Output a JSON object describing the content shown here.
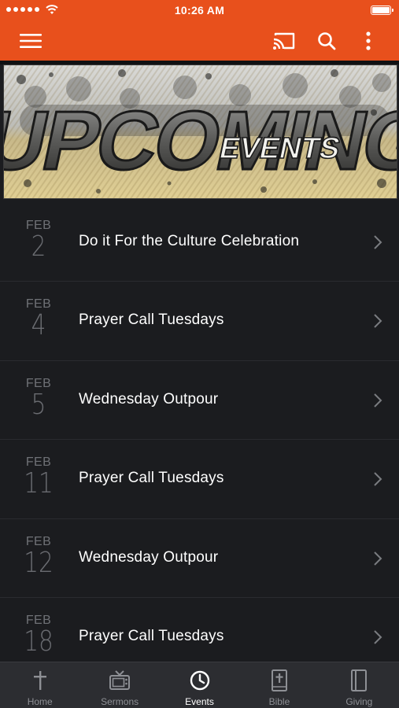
{
  "status_bar": {
    "time": "10:26 AM",
    "signal_icon": "signal-dots-icon",
    "wifi_icon": "wifi-icon",
    "battery_icon": "battery-icon"
  },
  "header": {
    "menu_icon": "hamburger-menu-icon",
    "cast_icon": "cast-icon",
    "search_icon": "search-icon",
    "more_icon": "more-vertical-icon",
    "accent_color": "#e8501c"
  },
  "banner": {
    "headline": "UPCOMING",
    "subheadline": "EVENTS"
  },
  "events": [
    {
      "month": "FEB",
      "day": "2",
      "title": "Do it For the Culture Celebration"
    },
    {
      "month": "FEB",
      "day": "4",
      "title": "Prayer Call Tuesdays"
    },
    {
      "month": "FEB",
      "day": "5",
      "title": "Wednesday Outpour"
    },
    {
      "month": "FEB",
      "day": "11",
      "title": "Prayer Call Tuesdays"
    },
    {
      "month": "FEB",
      "day": "12",
      "title": "Wednesday Outpour"
    },
    {
      "month": "FEB",
      "day": "18",
      "title": "Prayer Call Tuesdays"
    }
  ],
  "tabs": [
    {
      "label": "Home",
      "icon": "cross-icon",
      "active": false
    },
    {
      "label": "Sermons",
      "icon": "tv-icon",
      "active": false
    },
    {
      "label": "Events",
      "icon": "clock-icon",
      "active": true
    },
    {
      "label": "Bible",
      "icon": "bible-icon",
      "active": false
    },
    {
      "label": "Giving",
      "icon": "book-icon",
      "active": false
    }
  ]
}
